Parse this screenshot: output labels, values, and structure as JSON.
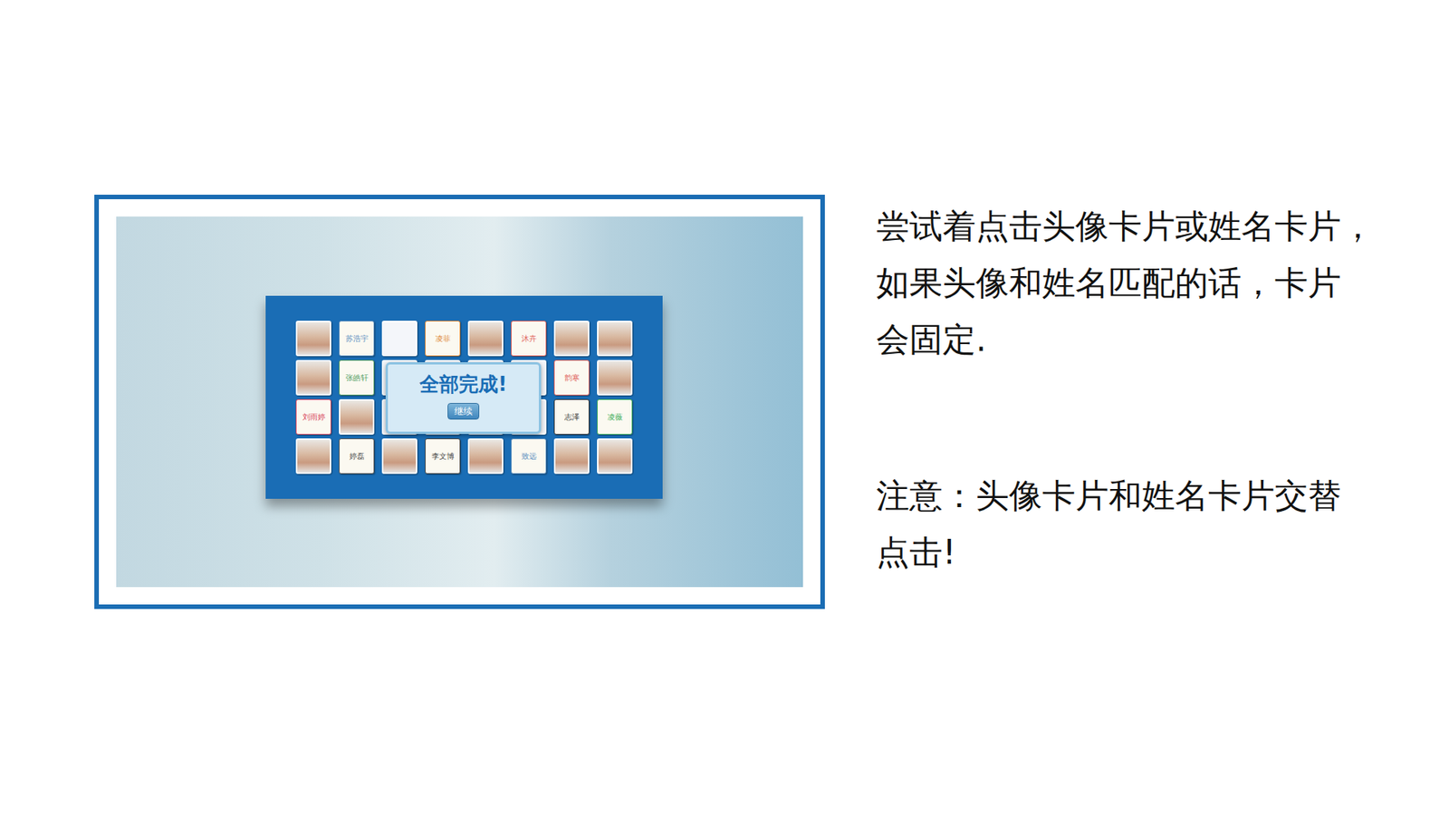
{
  "board": {
    "cards": [
      [
        {
          "kind": "photo"
        },
        {
          "kind": "name",
          "text": "苏浩宇",
          "color": "#5b8fc0"
        },
        {
          "kind": "blank"
        },
        {
          "kind": "name",
          "text": "凌菲",
          "color": "#e08a3a"
        },
        {
          "kind": "photo"
        },
        {
          "kind": "name",
          "text": "沐卉",
          "color": "#e0605a"
        },
        {
          "kind": "photo"
        },
        {
          "kind": "photo"
        }
      ],
      [
        {
          "kind": "photo"
        },
        {
          "kind": "name",
          "text": "张皓轩",
          "color": "#4d9a5e"
        },
        {
          "kind": "blank"
        },
        {
          "kind": "blank"
        },
        {
          "kind": "blank"
        },
        {
          "kind": "blank"
        },
        {
          "kind": "name",
          "text": "韵寒",
          "color": "#e0605a"
        },
        {
          "kind": "photo"
        }
      ],
      [
        {
          "kind": "name",
          "text": "刘雨婷",
          "color": "#d9485f"
        },
        {
          "kind": "photo"
        },
        {
          "kind": "blank"
        },
        {
          "kind": "blank"
        },
        {
          "kind": "blank"
        },
        {
          "kind": "blank"
        },
        {
          "kind": "name",
          "text": "志泽",
          "color": "#333333"
        },
        {
          "kind": "name",
          "text": "凌薇",
          "color": "#3fae5a"
        }
      ],
      [
        {
          "kind": "photo"
        },
        {
          "kind": "name",
          "text": "婷磊",
          "color": "#555555"
        },
        {
          "kind": "photo"
        },
        {
          "kind": "name",
          "text": "李文博",
          "color": "#444444"
        },
        {
          "kind": "photo"
        },
        {
          "kind": "name",
          "text": "致远",
          "color": "#5b8fc0"
        },
        {
          "kind": "photo"
        },
        {
          "kind": "photo"
        }
      ]
    ]
  },
  "dialog": {
    "title": "全部完成!",
    "button": "继续"
  },
  "instructions": {
    "paragraphs": [
      {
        "lines": [
          "尝试着点击头像卡片或姓名卡片，",
          "如果头像和姓名匹配的话，卡片",
          "会固定."
        ]
      },
      {
        "lines": [
          "注意：头像卡片和姓名卡片交替",
          "点击!"
        ]
      }
    ]
  }
}
